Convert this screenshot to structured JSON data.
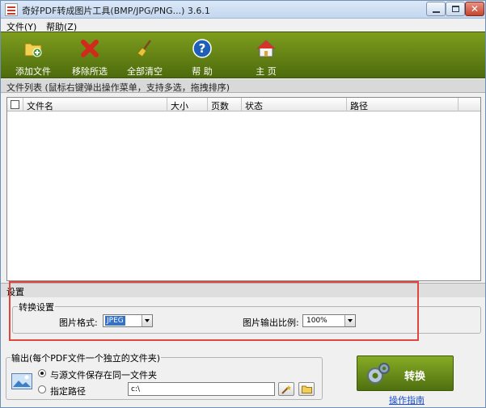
{
  "window": {
    "title": "奇好PDF转成图片工具(BMP/JPG/PNG...) 3.6.1"
  },
  "menu": [
    {
      "label": "文件(Y)"
    },
    {
      "label": "帮助(Z)"
    }
  ],
  "toolbar": {
    "buttons": [
      {
        "label": "添加文件",
        "icon": "add-file-icon"
      },
      {
        "label": "移除所选",
        "icon": "remove-icon"
      },
      {
        "label": "全部清空",
        "icon": "broom-icon"
      },
      {
        "label": "帮 助",
        "icon": "help-icon"
      },
      {
        "label": "主 页",
        "icon": "home-icon"
      }
    ]
  },
  "filelist": {
    "caption": "文件列表  (鼠标右键弹出操作菜单，支持多选，拖拽排序)",
    "columns": [
      "文件名",
      "大小",
      "页数",
      "状态",
      "路径"
    ]
  },
  "settings": {
    "header": "设置",
    "group_title": "转换设置",
    "format_label": "图片格式:",
    "format_value": "JPEG",
    "ratio_label": "图片输出比例:",
    "ratio_value": "100%"
  },
  "output": {
    "group_title": "输出(每个PDF文件一个独立的文件夹)",
    "option_same": "与源文件保存在同一文件夹",
    "option_custom": "指定路径",
    "selected": "same",
    "path_value": "c:\\"
  },
  "actions": {
    "convert_label": "转换",
    "guide_label": "操作指南"
  },
  "colors": {
    "toolbar": "#5f7d14",
    "highlight_box": "#e0463f",
    "link": "#1a4fd4"
  }
}
